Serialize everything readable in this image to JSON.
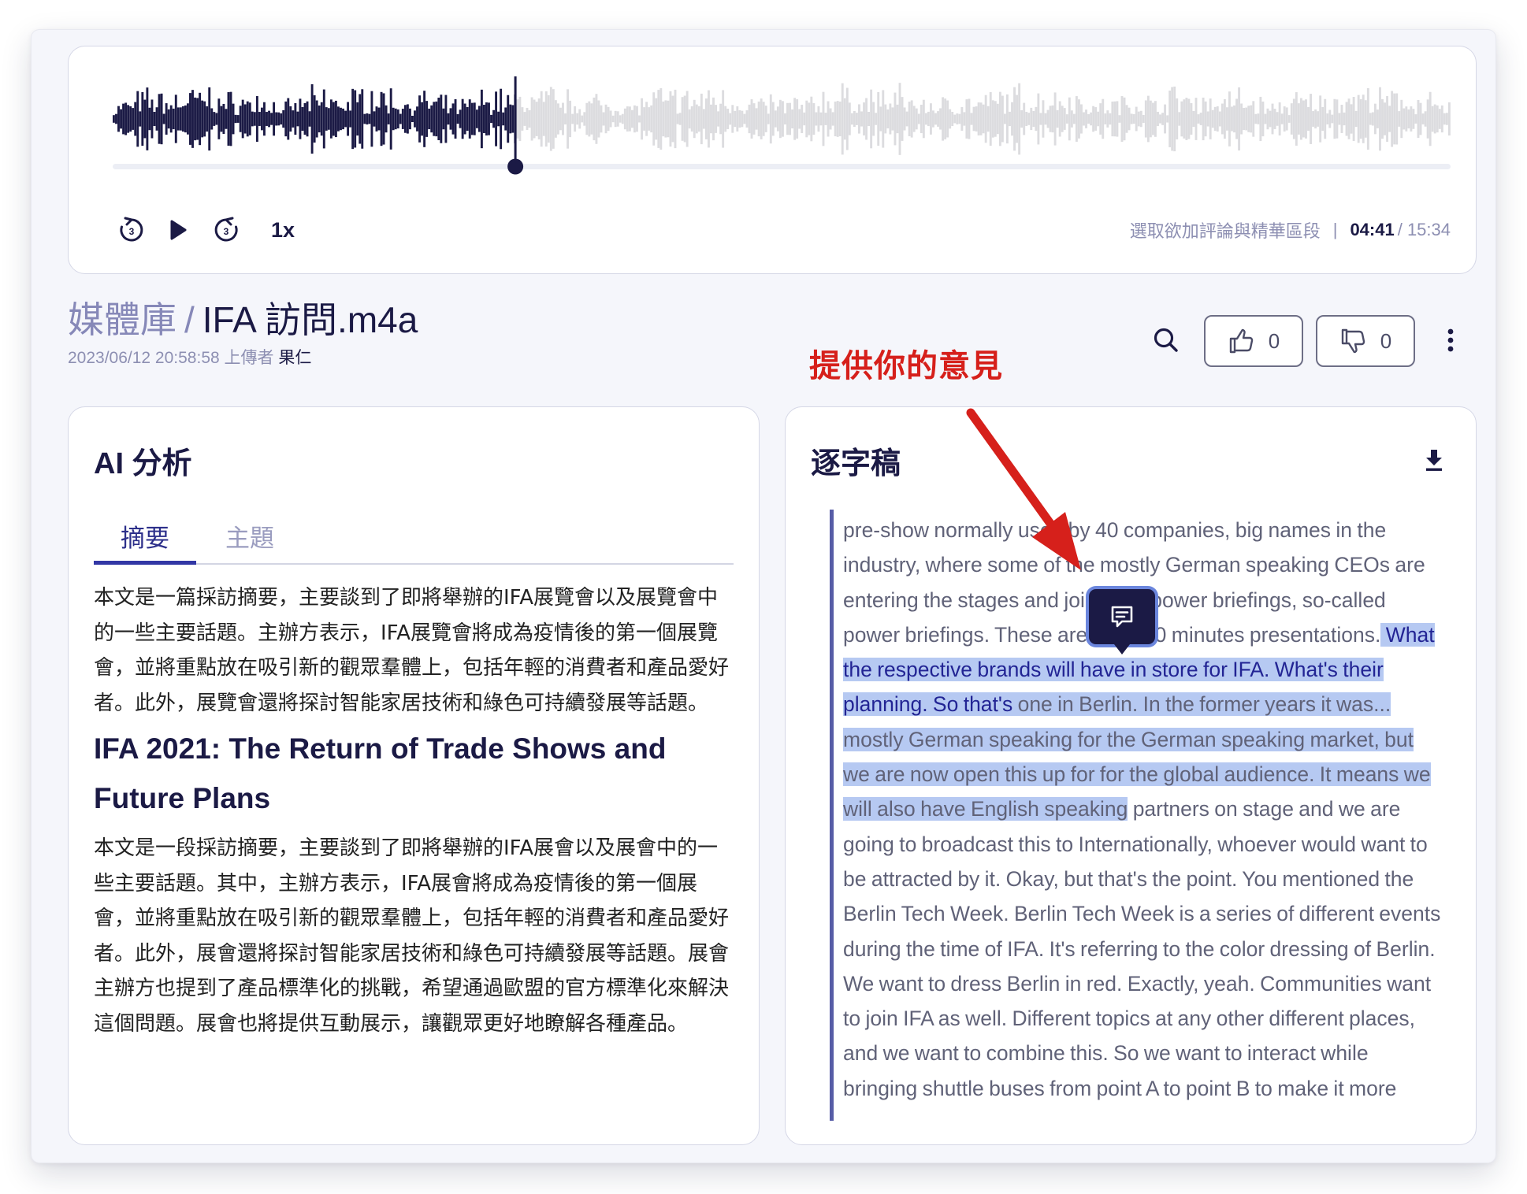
{
  "player": {
    "progress": 0.301,
    "speed": "1x",
    "hint": "選取欲加評論與精華區段",
    "separator": "|",
    "current_time": "04:41",
    "total_time": "/ 15:34"
  },
  "header": {
    "library": "媒體庫",
    "slash": "/",
    "filename": "IFA 訪問.m4a",
    "meta_prefix": "2023/06/12 20:58:58 上傳者",
    "uploader": "果仁",
    "likes": "0",
    "dislikes": "0"
  },
  "annotation": {
    "label": "提供你的意見"
  },
  "ai_panel": {
    "title": "AI 分析",
    "tabs": [
      {
        "label": "摘要",
        "active": true
      },
      {
        "label": "主題",
        "active": false
      }
    ],
    "summary_1": "本文是一篇採訪摘要，主要談到了即將舉辦的IFA展覽會以及展覽會中的一些主要話題。主辦方表示，IFA展覽會將成為疫情後的第一個展覽會，並將重點放在吸引新的觀眾羣體上，包括年輕的消費者和產品愛好者。此外，展覽會還將探討智能家居技術和綠色可持續發展等話題。",
    "heading": "IFA 2021: The Return of Trade Shows and Future Plans",
    "summary_2": "本文是一段採訪摘要，主要談到了即將舉辦的IFA展會以及展會中的一些主要話題。其中，主辦方表示，IFA展會將成為疫情後的第一個展會，並將重點放在吸引新的觀眾羣體上，包括年輕的消費者和產品愛好者。此外，展會還將探討智能家居技術和綠色可持續發展等話題。展會主辦方也提到了產品標準化的挑戰，希望通過歐盟的官方標準化來解決這個問題。展會也將提供互動展示，讓觀眾更好地瞭解各種產品。"
  },
  "transcript": {
    "title": "逐字稿",
    "seg_1": "pre-show normally used by 40 companies, big names in the industry, where some of the mostly German speaking CEOs are entering the stages and joining in power briefings, so-called power briefings. These are 15 to 20 minutes presentations.",
    "seg_2": " What the respective brands will have in store for IFA. What's their planning. So that's",
    "seg_3": " one in Berlin. In the former years it was... mostly German speaking for the German speaking market, but we are now open this up for for the global audience. It means we will also have English speaking",
    "seg_4": " partners on stage and we are going to broadcast this to Internationally, whoever would want to be attracted by it. Okay, but that's the point. You mentioned the Berlin Tech Week. Berlin Tech Week is a series of different events during the time of IFA. It's referring to the color dressing of Berlin. We want to dress Berlin in red. Exactly, yeah. Communities want to join IFA as well. Different topics at any other different places, and we want to combine this. So we want to interact while bringing shuttle buses from point A to point B to make it more"
  },
  "colors": {
    "accent": "#3237a5",
    "navy": "#1b1a45",
    "highlight": "#b6c9f2",
    "annotation_red": "#d6201b"
  }
}
